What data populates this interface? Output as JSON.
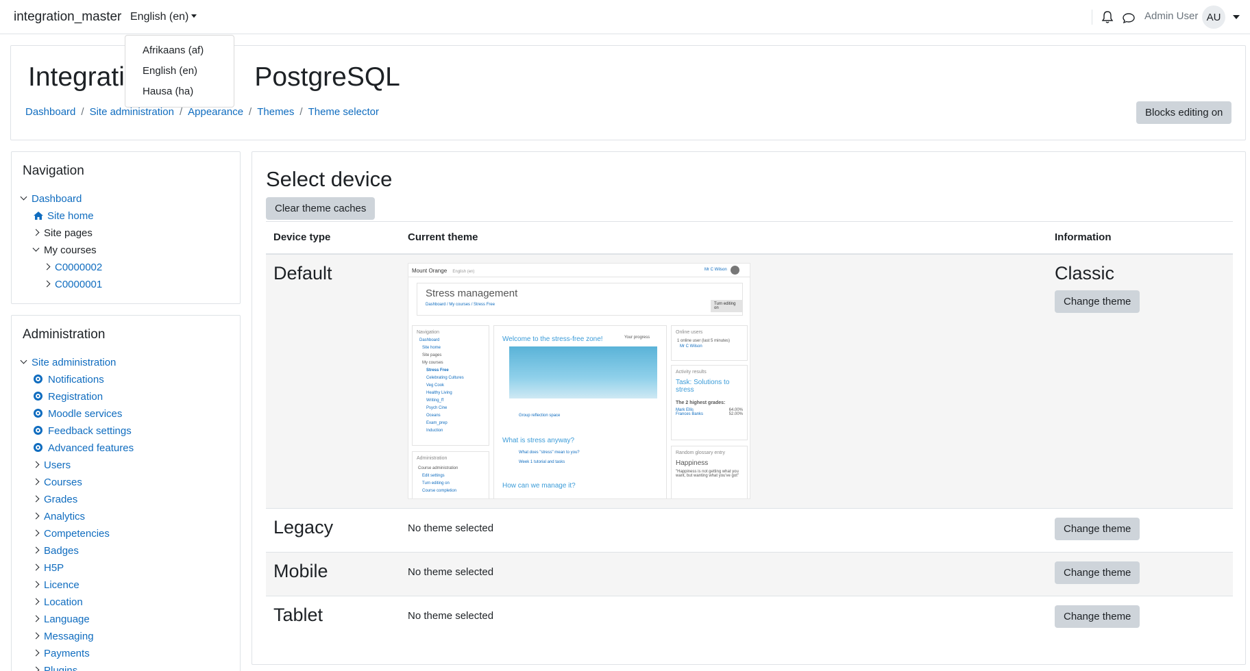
{
  "navbar": {
    "brand": "integration_master",
    "language": "English (en)",
    "user_name": "Admin User",
    "avatar_initials": "AU"
  },
  "language_menu": {
    "items": [
      "Afrikaans (af)",
      "English (en)",
      "Hausa (ha)"
    ]
  },
  "header": {
    "title": "Integration master PostgreSQL",
    "title_visible_left": "Integratic",
    "title_visible_right": "PostgreSQL",
    "breadcrumb": [
      "Dashboard",
      "Site administration",
      "Appearance",
      "Themes",
      "Theme selector"
    ],
    "blocks_button": "Blocks editing on"
  },
  "navigation": {
    "title": "Navigation",
    "items": [
      {
        "label": "Dashboard"
      },
      {
        "label": "Site home"
      },
      {
        "label": "Site pages"
      },
      {
        "label": "My courses"
      },
      {
        "label": "C0000002"
      },
      {
        "label": "C0000001"
      }
    ]
  },
  "administration": {
    "title": "Administration",
    "items": [
      {
        "label": "Site administration"
      },
      {
        "label": "Notifications"
      },
      {
        "label": "Registration"
      },
      {
        "label": "Moodle services"
      },
      {
        "label": "Feedback settings"
      },
      {
        "label": "Advanced features"
      },
      {
        "label": "Users"
      },
      {
        "label": "Courses"
      },
      {
        "label": "Grades"
      },
      {
        "label": "Analytics"
      },
      {
        "label": "Competencies"
      },
      {
        "label": "Badges"
      },
      {
        "label": "H5P"
      },
      {
        "label": "Licence"
      },
      {
        "label": "Location"
      },
      {
        "label": "Language"
      },
      {
        "label": "Messaging"
      },
      {
        "label": "Payments"
      },
      {
        "label": "Plugins"
      }
    ]
  },
  "main": {
    "heading": "Select device",
    "clear_button": "Clear theme caches",
    "columns": [
      "Device type",
      "Current theme",
      "Information"
    ],
    "rows": [
      {
        "device": "Default",
        "current": "",
        "info": "Classic",
        "button": "Change theme"
      },
      {
        "device": "Legacy",
        "current": "No theme selected",
        "info": "",
        "button": "Change theme"
      },
      {
        "device": "Mobile",
        "current": "No theme selected",
        "info": "",
        "button": "Change theme"
      },
      {
        "device": "Tablet",
        "current": "No theme selected",
        "info": "",
        "button": "Change theme"
      }
    ]
  },
  "preview": {
    "site": "Mount Orange",
    "lang": "English (en)",
    "user": "Mr C Wilson",
    "course_title": "Stress management",
    "crumbs": "Dashboard / My courses / Stress Free",
    "edit_btn": "Turn editing on",
    "nav_title": "Navigation",
    "nav_items": [
      "Dashboard",
      "Site home",
      "Site pages",
      "My courses",
      "Stress Free",
      "Celebrating Cultures",
      "Veg Cook",
      "Healthy Living",
      "Writing_ff",
      "Psych Cine",
      "Oceans",
      "Exam_prep",
      "Induction"
    ],
    "admin_title": "Administration",
    "admin_items": [
      "Course administration",
      "Edit settings",
      "Turn editing on",
      "Course completion"
    ],
    "welcome": "Welcome to the stress-free zone!",
    "progress": "Your progress",
    "group_space": "Group reflection space",
    "section2": "What is stress anyway?",
    "item_a": "What does \"stress\" mean to you?",
    "item_b": "Week 1 tutorial and tasks",
    "section3": "How can we manage it?",
    "online_title": "Online users",
    "online_count": "1 online user (last 5 minutes)",
    "activity_title": "Activity results",
    "activity_task": "Task: Solutions to stress",
    "grades_title": "The 2 highest grades:",
    "grade1_name": "Mark Ellis",
    "grade1_val": "64.00%",
    "grade2_name": "Frances Banks",
    "grade2_val": "52.00%",
    "glossary_title": "Random glossary entry",
    "glossary_word": "Happiness",
    "glossary_quote": "\"Happiness is not getting what you want, but wanting what you've got\""
  }
}
